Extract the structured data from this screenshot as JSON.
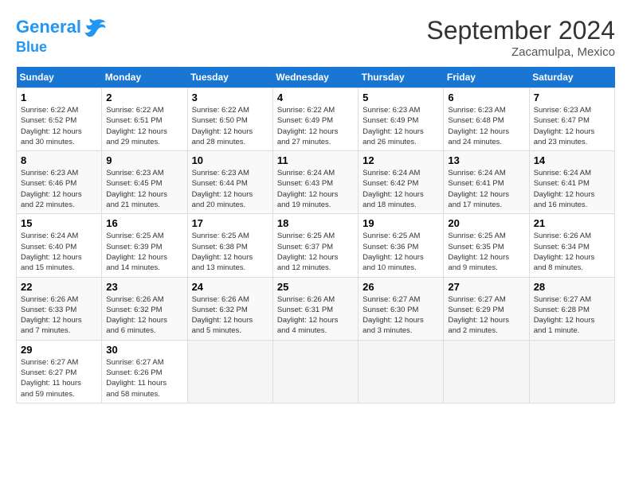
{
  "header": {
    "logo_line1": "General",
    "logo_line2": "Blue",
    "month_title": "September 2024",
    "location": "Zacamulpa, Mexico"
  },
  "days_of_week": [
    "Sunday",
    "Monday",
    "Tuesday",
    "Wednesday",
    "Thursday",
    "Friday",
    "Saturday"
  ],
  "weeks": [
    [
      {
        "num": "1",
        "info": "Sunrise: 6:22 AM\nSunset: 6:52 PM\nDaylight: 12 hours\nand 30 minutes."
      },
      {
        "num": "2",
        "info": "Sunrise: 6:22 AM\nSunset: 6:51 PM\nDaylight: 12 hours\nand 29 minutes."
      },
      {
        "num": "3",
        "info": "Sunrise: 6:22 AM\nSunset: 6:50 PM\nDaylight: 12 hours\nand 28 minutes."
      },
      {
        "num": "4",
        "info": "Sunrise: 6:22 AM\nSunset: 6:49 PM\nDaylight: 12 hours\nand 27 minutes."
      },
      {
        "num": "5",
        "info": "Sunrise: 6:23 AM\nSunset: 6:49 PM\nDaylight: 12 hours\nand 26 minutes."
      },
      {
        "num": "6",
        "info": "Sunrise: 6:23 AM\nSunset: 6:48 PM\nDaylight: 12 hours\nand 24 minutes."
      },
      {
        "num": "7",
        "info": "Sunrise: 6:23 AM\nSunset: 6:47 PM\nDaylight: 12 hours\nand 23 minutes."
      }
    ],
    [
      {
        "num": "8",
        "info": "Sunrise: 6:23 AM\nSunset: 6:46 PM\nDaylight: 12 hours\nand 22 minutes."
      },
      {
        "num": "9",
        "info": "Sunrise: 6:23 AM\nSunset: 6:45 PM\nDaylight: 12 hours\nand 21 minutes."
      },
      {
        "num": "10",
        "info": "Sunrise: 6:23 AM\nSunset: 6:44 PM\nDaylight: 12 hours\nand 20 minutes."
      },
      {
        "num": "11",
        "info": "Sunrise: 6:24 AM\nSunset: 6:43 PM\nDaylight: 12 hours\nand 19 minutes."
      },
      {
        "num": "12",
        "info": "Sunrise: 6:24 AM\nSunset: 6:42 PM\nDaylight: 12 hours\nand 18 minutes."
      },
      {
        "num": "13",
        "info": "Sunrise: 6:24 AM\nSunset: 6:41 PM\nDaylight: 12 hours\nand 17 minutes."
      },
      {
        "num": "14",
        "info": "Sunrise: 6:24 AM\nSunset: 6:41 PM\nDaylight: 12 hours\nand 16 minutes."
      }
    ],
    [
      {
        "num": "15",
        "info": "Sunrise: 6:24 AM\nSunset: 6:40 PM\nDaylight: 12 hours\nand 15 minutes."
      },
      {
        "num": "16",
        "info": "Sunrise: 6:25 AM\nSunset: 6:39 PM\nDaylight: 12 hours\nand 14 minutes."
      },
      {
        "num": "17",
        "info": "Sunrise: 6:25 AM\nSunset: 6:38 PM\nDaylight: 12 hours\nand 13 minutes."
      },
      {
        "num": "18",
        "info": "Sunrise: 6:25 AM\nSunset: 6:37 PM\nDaylight: 12 hours\nand 12 minutes."
      },
      {
        "num": "19",
        "info": "Sunrise: 6:25 AM\nSunset: 6:36 PM\nDaylight: 12 hours\nand 10 minutes."
      },
      {
        "num": "20",
        "info": "Sunrise: 6:25 AM\nSunset: 6:35 PM\nDaylight: 12 hours\nand 9 minutes."
      },
      {
        "num": "21",
        "info": "Sunrise: 6:26 AM\nSunset: 6:34 PM\nDaylight: 12 hours\nand 8 minutes."
      }
    ],
    [
      {
        "num": "22",
        "info": "Sunrise: 6:26 AM\nSunset: 6:33 PM\nDaylight: 12 hours\nand 7 minutes."
      },
      {
        "num": "23",
        "info": "Sunrise: 6:26 AM\nSunset: 6:32 PM\nDaylight: 12 hours\nand 6 minutes."
      },
      {
        "num": "24",
        "info": "Sunrise: 6:26 AM\nSunset: 6:32 PM\nDaylight: 12 hours\nand 5 minutes."
      },
      {
        "num": "25",
        "info": "Sunrise: 6:26 AM\nSunset: 6:31 PM\nDaylight: 12 hours\nand 4 minutes."
      },
      {
        "num": "26",
        "info": "Sunrise: 6:27 AM\nSunset: 6:30 PM\nDaylight: 12 hours\nand 3 minutes."
      },
      {
        "num": "27",
        "info": "Sunrise: 6:27 AM\nSunset: 6:29 PM\nDaylight: 12 hours\nand 2 minutes."
      },
      {
        "num": "28",
        "info": "Sunrise: 6:27 AM\nSunset: 6:28 PM\nDaylight: 12 hours\nand 1 minute."
      }
    ],
    [
      {
        "num": "29",
        "info": "Sunrise: 6:27 AM\nSunset: 6:27 PM\nDaylight: 11 hours\nand 59 minutes."
      },
      {
        "num": "30",
        "info": "Sunrise: 6:27 AM\nSunset: 6:26 PM\nDaylight: 11 hours\nand 58 minutes."
      },
      {
        "num": "",
        "info": ""
      },
      {
        "num": "",
        "info": ""
      },
      {
        "num": "",
        "info": ""
      },
      {
        "num": "",
        "info": ""
      },
      {
        "num": "",
        "info": ""
      }
    ]
  ]
}
